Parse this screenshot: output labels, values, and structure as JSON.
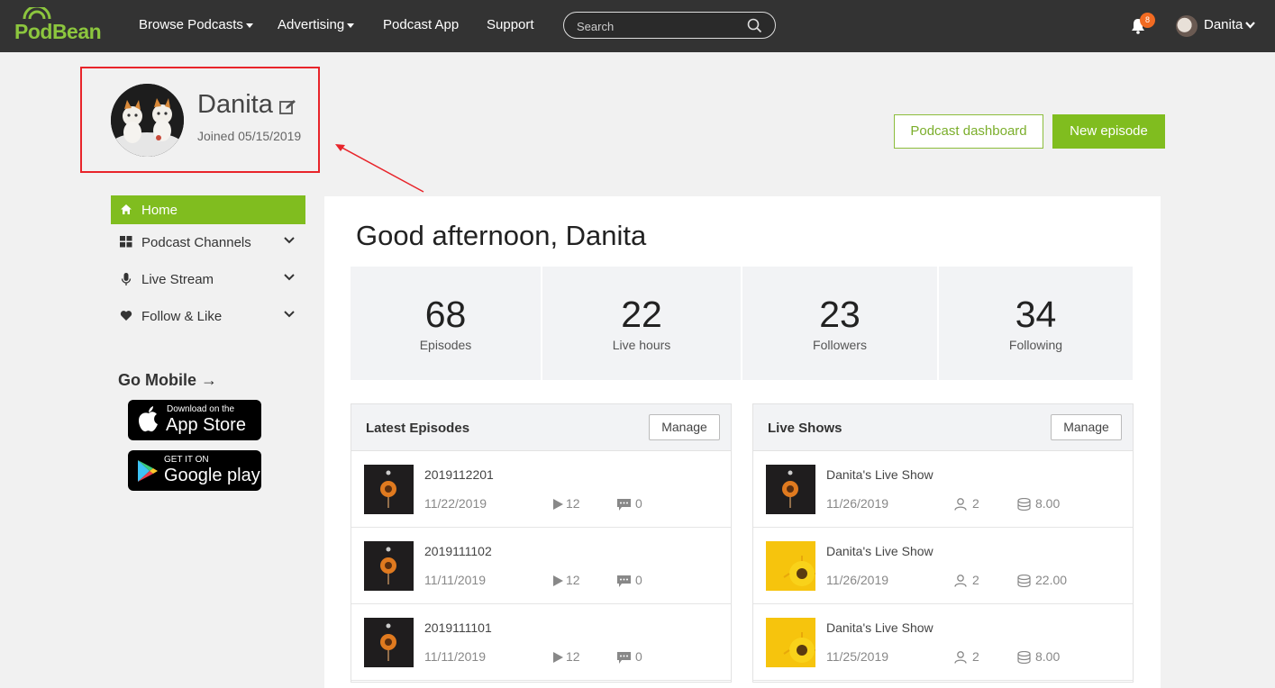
{
  "header": {
    "logo": "PodBean",
    "nav": [
      "Browse Podcasts",
      "Advertising",
      "Podcast App",
      "Support"
    ],
    "search_placeholder": "Search",
    "notification_count": "8",
    "user_name": "Danita"
  },
  "profile": {
    "name": "Danita",
    "joined": "Joined 05/15/2019"
  },
  "actions": {
    "dashboard": "Podcast dashboard",
    "new_episode": "New episode"
  },
  "sidebar": {
    "items": [
      {
        "label": "Home",
        "icon": "home-icon"
      },
      {
        "label": "Podcast Channels",
        "icon": "grid-icon"
      },
      {
        "label": "Live Stream",
        "icon": "microphone-icon"
      },
      {
        "label": "Follow & Like",
        "icon": "heart-icon"
      }
    ],
    "go_mobile": "Go Mobile →",
    "app_store": {
      "small": "Download on the",
      "big": "App Store"
    },
    "google_play": {
      "small": "GET IT ON",
      "big": "Google play"
    }
  },
  "main": {
    "greeting": "Good afternoon, Danita",
    "stats": [
      {
        "value": "68",
        "label": "Episodes"
      },
      {
        "value": "22",
        "label": "Live hours"
      },
      {
        "value": "23",
        "label": "Followers"
      },
      {
        "value": "34",
        "label": "Following"
      }
    ],
    "latest_episodes": {
      "title": "Latest Episodes",
      "manage": "Manage",
      "rows": [
        {
          "title": "2019112201",
          "date": "11/22/2019",
          "plays": "12",
          "comments": "0"
        },
        {
          "title": "2019111102",
          "date": "11/11/2019",
          "plays": "12",
          "comments": "0"
        },
        {
          "title": "2019111101",
          "date": "11/11/2019",
          "plays": "12",
          "comments": "0"
        }
      ]
    },
    "live_shows": {
      "title": "Live Shows",
      "manage": "Manage",
      "rows": [
        {
          "title": "Danita's Live Show",
          "date": "11/26/2019",
          "listeners": "2",
          "coins": "8.00"
        },
        {
          "title": "Danita's Live Show",
          "date": "11/26/2019",
          "listeners": "2",
          "coins": "22.00"
        },
        {
          "title": "Danita's Live Show",
          "date": "11/25/2019",
          "listeners": "2",
          "coins": "8.00"
        }
      ]
    }
  },
  "colors": {
    "brand": "#80bd1f",
    "topbar": "#333333",
    "highlight": "#e8242a"
  }
}
